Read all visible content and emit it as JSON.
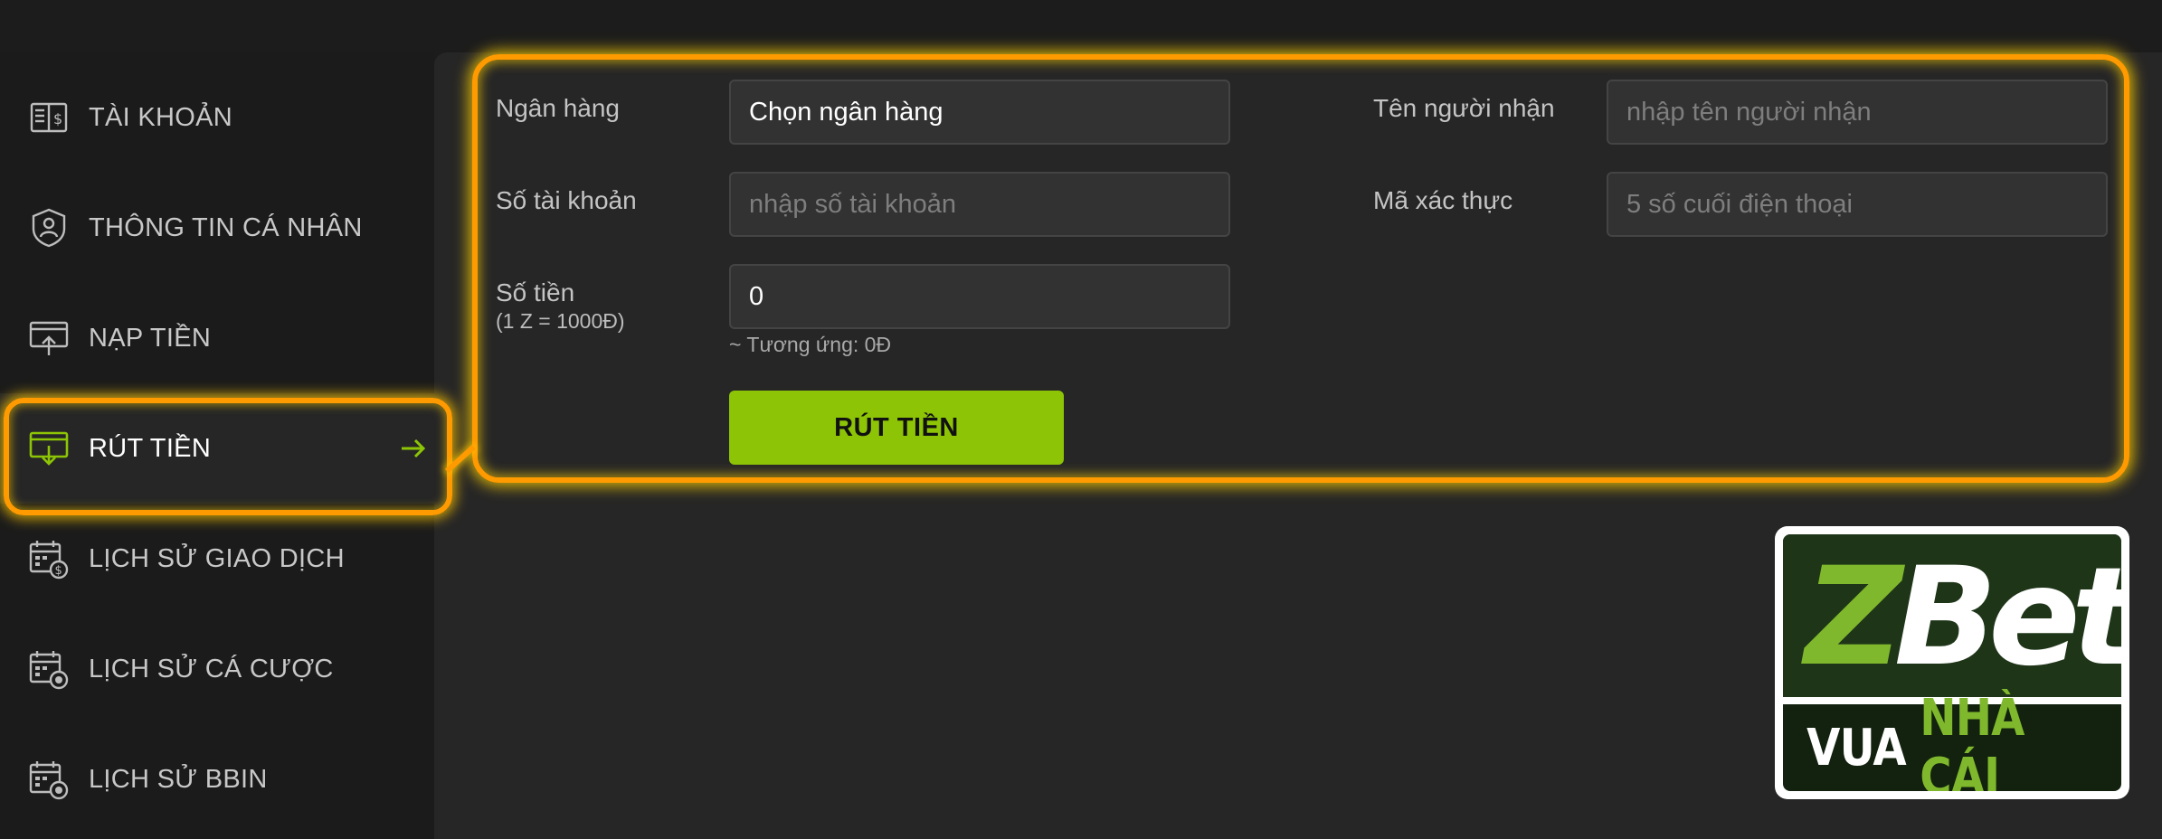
{
  "sidebar": {
    "items": [
      {
        "label": "TÀI KHOẢN",
        "icon": "account-book-icon"
      },
      {
        "label": "THÔNG TIN CÁ NHÂN",
        "icon": "user-shield-icon"
      },
      {
        "label": "NẠP TIỀN",
        "icon": "deposit-icon"
      },
      {
        "label": "RÚT TIỀN",
        "icon": "withdraw-icon",
        "active": true
      },
      {
        "label": "LỊCH SỬ GIAO DỊCH",
        "icon": "calendar-dollar-icon"
      },
      {
        "label": "LỊCH SỬ CÁ CƯỢC",
        "icon": "calendar-bet-icon"
      },
      {
        "label": "LỊCH SỬ BBIN",
        "icon": "calendar-bbin-icon"
      }
    ]
  },
  "form": {
    "bank_label": "Ngân hàng",
    "bank_value": "Chọn ngân hàng",
    "recipient_label": "Tên người nhận",
    "recipient_placeholder": "nhập tên người nhận",
    "account_label": "Số tài khoản",
    "account_placeholder": "nhập số tài khoản",
    "verify_label": "Mã xác thực",
    "verify_placeholder": "5 số cuối điện thoại",
    "amount_label": "Số tiền",
    "amount_sublabel": "(1 Z = 1000Đ)",
    "amount_value": "0",
    "amount_hint": "~ Tương ứng: 0Đ",
    "submit_label": "RÚT TIỀN"
  },
  "logo": {
    "word_z": "Z",
    "word_bet": "Bet",
    "tagline_white": "VUA",
    "tagline_green": "NHÀ CÁI"
  },
  "colors": {
    "accent_green": "#8dc506",
    "highlight_orange": "#ff9a00",
    "background": "#1c1c1c",
    "panel": "#262626"
  }
}
